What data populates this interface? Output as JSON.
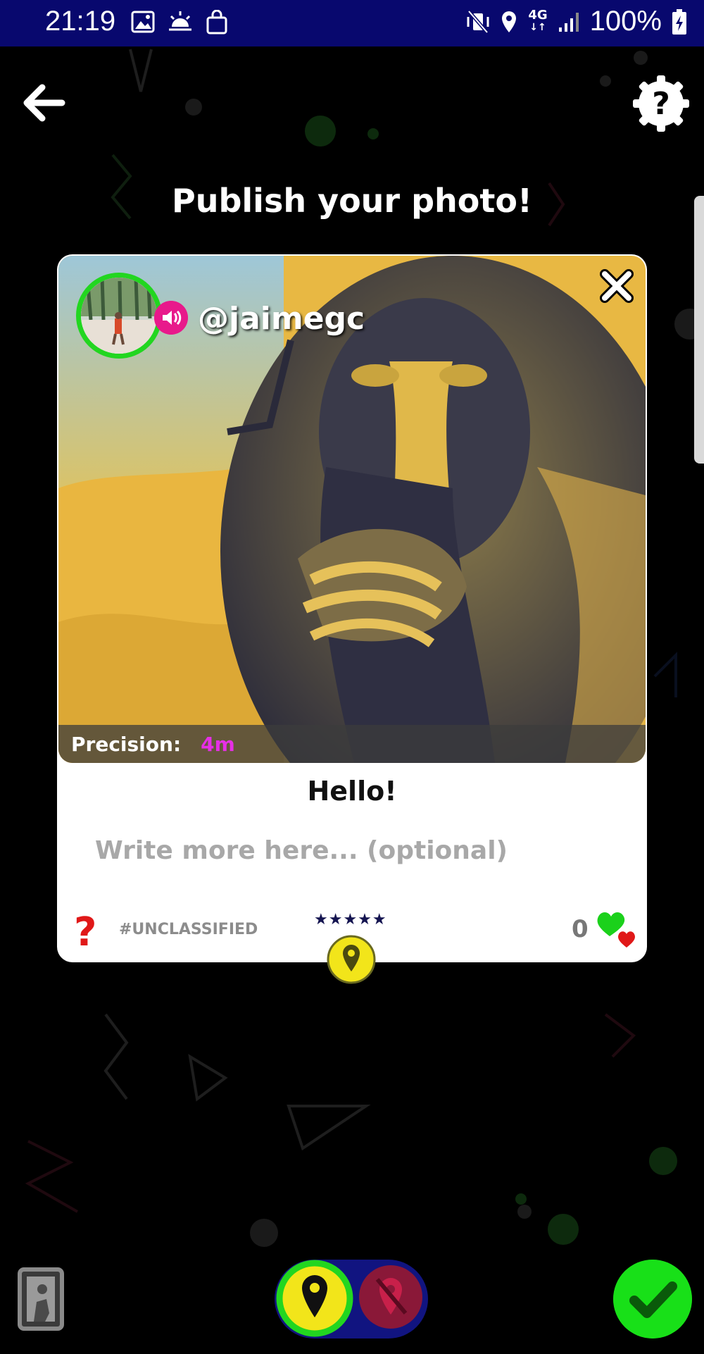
{
  "status_bar": {
    "time": "21:19",
    "network": "4G",
    "battery": "100%",
    "left_icons": [
      "image-icon",
      "sunrise-icon",
      "shopping-bag-icon"
    ],
    "right_icons": [
      "vibrate-mute-icon",
      "location-icon",
      "network-4g-icon",
      "signal-icon",
      "battery-charging-icon"
    ]
  },
  "header": {
    "back_icon": "arrow-left-icon",
    "help_icon": "help-gear-icon",
    "title": "Publish your photo!"
  },
  "card": {
    "username": "@jaimegc",
    "precision_label": "Precision:",
    "precision_value": "4m",
    "caption": "Hello!",
    "more_placeholder": "Write more here... (optional)",
    "category": "#UNCLASSIFIED",
    "stars": "★★★★★",
    "likes": "0",
    "close_icon": "close-icon",
    "sound_icon": "speaker-icon",
    "category_icon": "question-mark-icon",
    "pin_icon": "map-pin-icon",
    "hearts_icon": "hearts-icon"
  },
  "bottom_bar": {
    "gallery_icon": "gallery-photo-icon",
    "location_on_icon": "map-pin-icon",
    "location_off_icon": "map-pin-off-icon",
    "confirm_icon": "checkmark-icon"
  },
  "colors": {
    "status_bar": "#08086e",
    "accent_green": "#18e018",
    "accent_pink": "#e8198b",
    "precision_value": "#e62fe6",
    "pin_yellow": "#f2e51a",
    "toggle_blue": "#111480",
    "off_red": "#8a1838"
  }
}
